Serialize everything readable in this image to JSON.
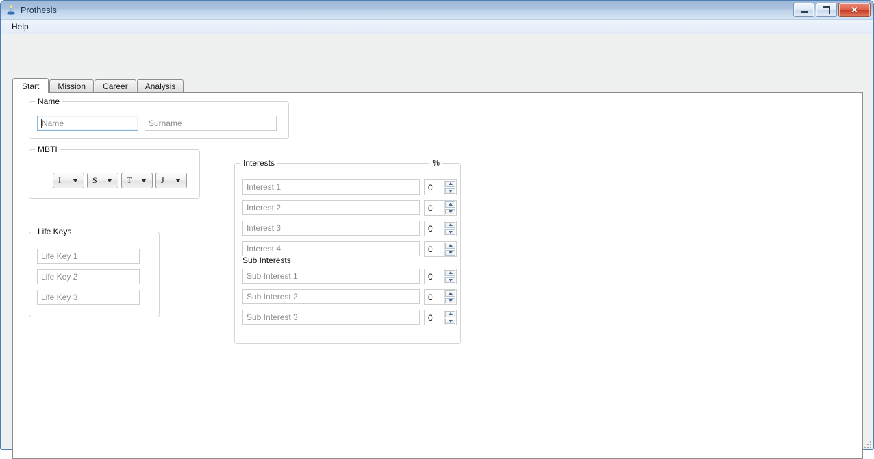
{
  "window": {
    "title": "Prothesis",
    "icon": "app-icon",
    "controls": {
      "minimize": "minimize-button",
      "maximize": "maximize-button",
      "close": "close-button",
      "close_glyph": "✕"
    }
  },
  "menubar": {
    "items": [
      {
        "label": "Help"
      }
    ]
  },
  "tabs": [
    {
      "label": "Start",
      "active": true
    },
    {
      "label": "Mission",
      "active": false
    },
    {
      "label": "Career",
      "active": false
    },
    {
      "label": "Analysis",
      "active": false
    }
  ],
  "groups": {
    "name": {
      "title": "Name",
      "fields": [
        {
          "placeholder": "Name",
          "value": "",
          "focused": true
        },
        {
          "placeholder": "Surname",
          "value": "",
          "focused": false
        }
      ]
    },
    "mbti": {
      "title": "MBTI",
      "selects": [
        {
          "value": "I"
        },
        {
          "value": "S"
        },
        {
          "value": "T"
        },
        {
          "value": "J"
        }
      ]
    },
    "life_keys": {
      "title": "Life Keys",
      "fields": [
        {
          "placeholder": "Life Key 1",
          "value": ""
        },
        {
          "placeholder": "Life Key 2",
          "value": ""
        },
        {
          "placeholder": "Life Key 3",
          "value": ""
        }
      ]
    },
    "interests": {
      "title": "Interests",
      "percent_label": "%",
      "sub_title": "Sub Interests",
      "rows": [
        {
          "placeholder": "Interest 1",
          "value": "",
          "percent": "0"
        },
        {
          "placeholder": "Interest 2",
          "value": "",
          "percent": "0"
        },
        {
          "placeholder": "Interest 3",
          "value": "",
          "percent": "0"
        },
        {
          "placeholder": "Interest 4",
          "value": "",
          "percent": "0"
        }
      ],
      "sub_rows": [
        {
          "placeholder": "Sub Interest 1",
          "value": "",
          "percent": "0"
        },
        {
          "placeholder": "Sub Interest 2",
          "value": "",
          "percent": "0"
        },
        {
          "placeholder": "Sub Interest 3",
          "value": "",
          "percent": "0"
        }
      ]
    }
  },
  "colors": {
    "titlebar_top": "#9db7d6",
    "titlebar_bottom": "#d6e4f3",
    "frame_border": "#4b7fb5",
    "close_button": "#c63a22",
    "focus_border": "#8bb6d8",
    "placeholder_text": "#8d8d8d",
    "groupbox_border": "#d5d5d5",
    "client_background": "#eff0f0",
    "page_background": "#ffffff"
  }
}
